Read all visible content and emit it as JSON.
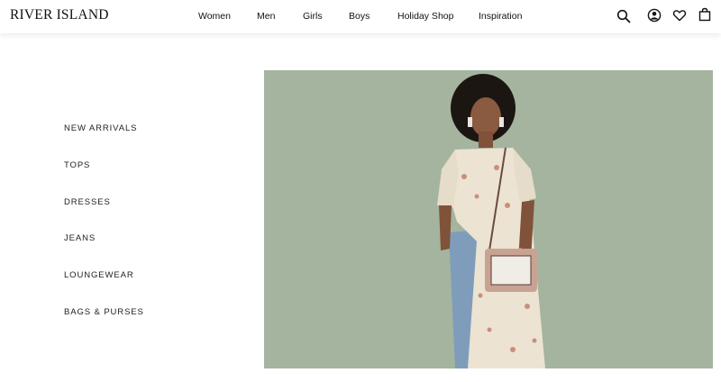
{
  "brand": {
    "name": "RIVER ISLAND"
  },
  "nav": {
    "items": [
      {
        "label": "Women"
      },
      {
        "label": "Men"
      },
      {
        "label": "Girls"
      },
      {
        "label": "Boys"
      },
      {
        "label": "Holiday Shop"
      },
      {
        "label": "Inspiration"
      }
    ]
  },
  "header_icons": [
    "search-icon",
    "account-icon",
    "wishlist-heart-icon",
    "shopping-bag-icon"
  ],
  "sidebar": {
    "links": [
      {
        "label": "NEW ARRIVALS"
      },
      {
        "label": "TOPS"
      },
      {
        "label": "DRESSES"
      },
      {
        "label": "JEANS"
      },
      {
        "label": "LOUNGEWEAR"
      },
      {
        "label": "BAGS & PURSES"
      }
    ]
  },
  "hero": {
    "background_color": "#a4b49e",
    "subject": "model-in-floral-maxi-shirt-dress-and-jeans"
  }
}
